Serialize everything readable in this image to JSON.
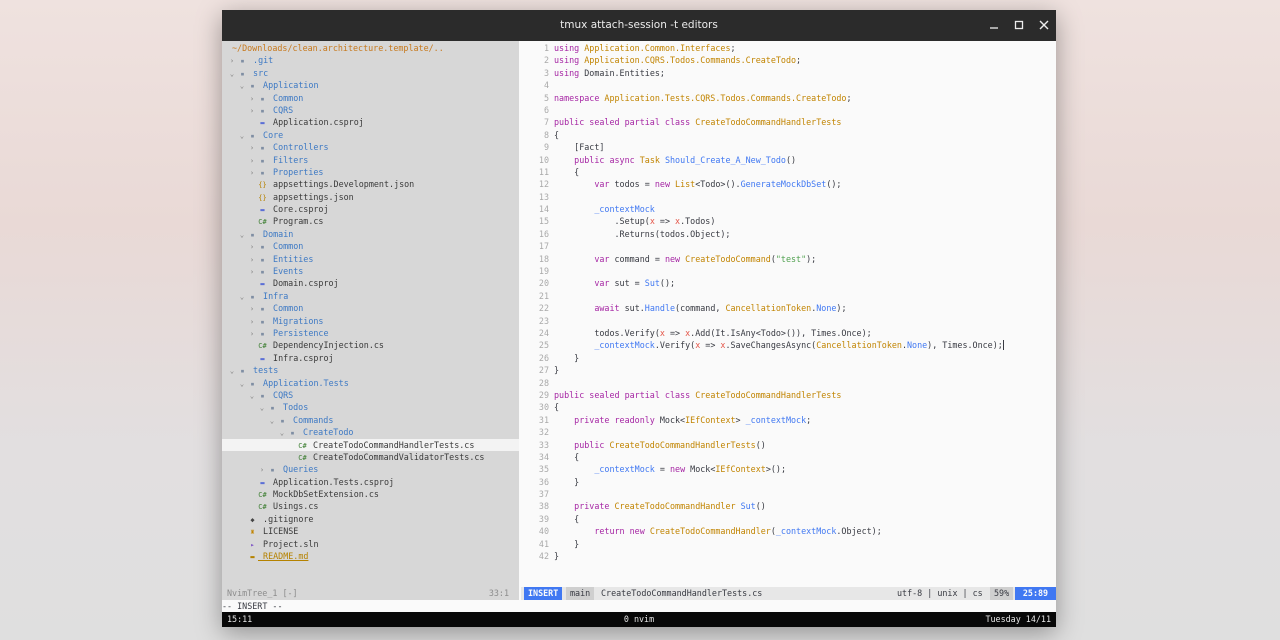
{
  "window": {
    "title": "tmux attach-session -t editors"
  },
  "sidebar": {
    "root": "~/Downloads/clean.architecture.template/..",
    "items": [
      {
        "depth": 0,
        "chev": "›",
        "icon": "folder",
        "name": ".git",
        "type": "dir"
      },
      {
        "depth": 0,
        "chev": "⌄",
        "icon": "folder",
        "name": "src",
        "type": "dir"
      },
      {
        "depth": 1,
        "chev": "⌄",
        "icon": "folder",
        "name": "Application",
        "type": "dir"
      },
      {
        "depth": 2,
        "chev": "›",
        "icon": "folder",
        "name": "Common",
        "type": "dir"
      },
      {
        "depth": 2,
        "chev": "›",
        "icon": "folder",
        "name": "CQRS",
        "type": "dir"
      },
      {
        "depth": 2,
        "chev": "",
        "icon": "csproj",
        "name": "Application.csproj",
        "type": "file"
      },
      {
        "depth": 1,
        "chev": "⌄",
        "icon": "folder",
        "name": "Core",
        "type": "dir"
      },
      {
        "depth": 2,
        "chev": "›",
        "icon": "folder",
        "name": "Controllers",
        "type": "dir"
      },
      {
        "depth": 2,
        "chev": "›",
        "icon": "folder",
        "name": "Filters",
        "type": "dir"
      },
      {
        "depth": 2,
        "chev": "›",
        "icon": "folder",
        "name": "Properties",
        "type": "dir"
      },
      {
        "depth": 2,
        "chev": "",
        "icon": "json",
        "name": "appsettings.Development.json",
        "type": "file"
      },
      {
        "depth": 2,
        "chev": "",
        "icon": "json",
        "name": "appsettings.json",
        "type": "file"
      },
      {
        "depth": 2,
        "chev": "",
        "icon": "csproj",
        "name": "Core.csproj",
        "type": "file"
      },
      {
        "depth": 2,
        "chev": "",
        "icon": "cs",
        "name": "Program.cs",
        "type": "file"
      },
      {
        "depth": 1,
        "chev": "⌄",
        "icon": "folder",
        "name": "Domain",
        "type": "dir"
      },
      {
        "depth": 2,
        "chev": "›",
        "icon": "folder",
        "name": "Common",
        "type": "dir"
      },
      {
        "depth": 2,
        "chev": "›",
        "icon": "folder",
        "name": "Entities",
        "type": "dir"
      },
      {
        "depth": 2,
        "chev": "›",
        "icon": "folder",
        "name": "Events",
        "type": "dir"
      },
      {
        "depth": 2,
        "chev": "",
        "icon": "csproj",
        "name": "Domain.csproj",
        "type": "file"
      },
      {
        "depth": 1,
        "chev": "⌄",
        "icon": "folder",
        "name": "Infra",
        "type": "dir"
      },
      {
        "depth": 2,
        "chev": "›",
        "icon": "folder",
        "name": "Common",
        "type": "dir"
      },
      {
        "depth": 2,
        "chev": "›",
        "icon": "folder",
        "name": "Migrations",
        "type": "dir"
      },
      {
        "depth": 2,
        "chev": "›",
        "icon": "folder",
        "name": "Persistence",
        "type": "dir"
      },
      {
        "depth": 2,
        "chev": "",
        "icon": "cs",
        "name": "DependencyInjection.cs",
        "type": "file"
      },
      {
        "depth": 2,
        "chev": "",
        "icon": "csproj",
        "name": "Infra.csproj",
        "type": "file"
      },
      {
        "depth": 0,
        "chev": "⌄",
        "icon": "folder",
        "name": "tests",
        "type": "dir"
      },
      {
        "depth": 1,
        "chev": "⌄",
        "icon": "folder",
        "name": "Application.Tests",
        "type": "dir"
      },
      {
        "depth": 2,
        "chev": "⌄",
        "icon": "folder",
        "name": "CQRS",
        "type": "dir"
      },
      {
        "depth": 3,
        "chev": "⌄",
        "icon": "folder",
        "name": "Todos",
        "type": "dir"
      },
      {
        "depth": 4,
        "chev": "⌄",
        "icon": "folder",
        "name": "Commands",
        "type": "dir"
      },
      {
        "depth": 5,
        "chev": "⌄",
        "icon": "folder",
        "name": "CreateTodo",
        "type": "dir"
      },
      {
        "depth": 6,
        "chev": "",
        "icon": "cs",
        "name": "CreateTodoCommandHandlerTests.cs",
        "type": "file",
        "selected": true
      },
      {
        "depth": 6,
        "chev": "",
        "icon": "cs",
        "name": "CreateTodoCommandValidatorTests.cs",
        "type": "file"
      },
      {
        "depth": 3,
        "chev": "›",
        "icon": "folder",
        "name": "Queries",
        "type": "dir"
      },
      {
        "depth": 2,
        "chev": "",
        "icon": "csproj",
        "name": "Application.Tests.csproj",
        "type": "file"
      },
      {
        "depth": 2,
        "chev": "",
        "icon": "cs",
        "name": "MockDbSetExtension.cs",
        "type": "file"
      },
      {
        "depth": 2,
        "chev": "",
        "icon": "cs",
        "name": "Usings.cs",
        "type": "file"
      },
      {
        "depth": 1,
        "chev": "",
        "icon": "git",
        "name": ".gitignore",
        "type": "file"
      },
      {
        "depth": 1,
        "chev": "",
        "icon": "license",
        "name": "LICENSE",
        "type": "file"
      },
      {
        "depth": 1,
        "chev": "",
        "icon": "sln",
        "name": "Project.sln",
        "type": "file"
      },
      {
        "depth": 1,
        "chev": "",
        "icon": "md",
        "name": "README.md",
        "type": "readme"
      }
    ]
  },
  "icon_glyphs": {
    "folder": "▪",
    "csproj": "▬",
    "json": "{}",
    "cs": "C#",
    "git": "◆",
    "license": "♜",
    "sln": "▸",
    "md": "▬"
  },
  "icon_colors": {
    "folder": "#7f8ea3",
    "csproj": "#5b6fd6",
    "json": "#b58200",
    "cs": "#3a7d2f",
    "git": "#444444",
    "license": "#c18401",
    "sln": "#7a4fc4",
    "md": "#b58200"
  },
  "editor": {
    "lines": [
      [
        [
          "k",
          "using "
        ],
        [
          "t",
          "Application.Common.Interfaces"
        ],
        [
          "x",
          ";"
        ]
      ],
      [
        [
          "k",
          "using "
        ],
        [
          "t",
          "Application.CQRS.Todos.Commands.CreateTodo"
        ],
        [
          "x",
          ";"
        ]
      ],
      [
        [
          "k",
          "using "
        ],
        [
          "x",
          "Domain.Entities;"
        ]
      ],
      [],
      [
        [
          "k",
          "namespace "
        ],
        [
          "t",
          "Application.Tests.CQRS.Todos.Commands.CreateTodo"
        ],
        [
          "x",
          ";"
        ]
      ],
      [],
      [
        [
          "k",
          "public sealed partial class "
        ],
        [
          "t",
          "CreateTodoCommandHandlerTests"
        ]
      ],
      [
        [
          "x",
          "{"
        ]
      ],
      [
        [
          "x",
          "    [Fact]"
        ]
      ],
      [
        [
          "x",
          "    "
        ],
        [
          "k",
          "public async "
        ],
        [
          "t",
          "Task "
        ],
        [
          "f",
          "Should_Create_A_New_Todo"
        ],
        [
          "x",
          "()"
        ]
      ],
      [
        [
          "x",
          "    {"
        ]
      ],
      [
        [
          "x",
          "        "
        ],
        [
          "k",
          "var "
        ],
        [
          "x",
          "todos = "
        ],
        [
          "k",
          "new "
        ],
        [
          "t",
          "List"
        ],
        [
          "x",
          "<Todo>()."
        ],
        [
          "f",
          "GenerateMockDbSet"
        ],
        [
          "x",
          "();"
        ]
      ],
      [],
      [
        [
          "x",
          "        "
        ],
        [
          "f",
          "_contextMock"
        ]
      ],
      [
        [
          "x",
          "            .Setup("
        ],
        [
          "m",
          "x"
        ],
        [
          "x",
          " => "
        ],
        [
          "m",
          "x"
        ],
        [
          "x",
          ".Todos)"
        ]
      ],
      [
        [
          "x",
          "            .Returns(todos.Object);"
        ]
      ],
      [],
      [
        [
          "x",
          "        "
        ],
        [
          "k",
          "var "
        ],
        [
          "x",
          "command = "
        ],
        [
          "k",
          "new "
        ],
        [
          "t",
          "CreateTodoCommand"
        ],
        [
          "x",
          "("
        ],
        [
          "s",
          "\"test\""
        ],
        [
          "x",
          ");"
        ]
      ],
      [],
      [
        [
          "x",
          "        "
        ],
        [
          "k",
          "var "
        ],
        [
          "x",
          "sut = "
        ],
        [
          "f",
          "Sut"
        ],
        [
          "x",
          "();"
        ]
      ],
      [],
      [
        [
          "x",
          "        "
        ],
        [
          "k",
          "await "
        ],
        [
          "x",
          "sut."
        ],
        [
          "f",
          "Handle"
        ],
        [
          "x",
          "(command, "
        ],
        [
          "t",
          "CancellationToken"
        ],
        [
          "x",
          "."
        ],
        [
          "f",
          "None"
        ],
        [
          "x",
          ");"
        ]
      ],
      [],
      [
        [
          "x",
          "        todos.Verify("
        ],
        [
          "m",
          "x"
        ],
        [
          "x",
          " => "
        ],
        [
          "m",
          "x"
        ],
        [
          "x",
          ".Add(It.IsAny<Todo>()), Times.Once);"
        ]
      ],
      [
        [
          "x",
          "        "
        ],
        [
          "f",
          "_contextMock"
        ],
        [
          "x",
          ".Verify("
        ],
        [
          "m",
          "x"
        ],
        [
          "x",
          " => "
        ],
        [
          "m",
          "x"
        ],
        [
          "x",
          ".SaveChangesAsync("
        ],
        [
          "t",
          "CancellationToken"
        ],
        [
          "x",
          "."
        ],
        [
          "f",
          "None"
        ],
        [
          "x",
          "), Times.Once)"
        ],
        [
          "c",
          ";"
        ]
      ],
      [
        [
          "x",
          "    }"
        ]
      ],
      [
        [
          "x",
          "}"
        ]
      ],
      [],
      [
        [
          "k",
          "public sealed partial class "
        ],
        [
          "t",
          "CreateTodoCommandHandlerTests"
        ]
      ],
      [
        [
          "x",
          "{"
        ]
      ],
      [
        [
          "x",
          "    "
        ],
        [
          "k",
          "private readonly "
        ],
        [
          "x",
          "Mock<"
        ],
        [
          "t",
          "IEfContext"
        ],
        [
          "x",
          "> "
        ],
        [
          "f",
          "_contextMock"
        ],
        [
          "x",
          ";"
        ]
      ],
      [],
      [
        [
          "x",
          "    "
        ],
        [
          "k",
          "public "
        ],
        [
          "t",
          "CreateTodoCommandHandlerTests"
        ],
        [
          "x",
          "()"
        ]
      ],
      [
        [
          "x",
          "    {"
        ]
      ],
      [
        [
          "x",
          "        "
        ],
        [
          "f",
          "_contextMock"
        ],
        [
          "x",
          " = "
        ],
        [
          "k",
          "new "
        ],
        [
          "x",
          "Mock<"
        ],
        [
          "t",
          "IEfContext"
        ],
        [
          "x",
          ">();"
        ]
      ],
      [
        [
          "x",
          "    }"
        ]
      ],
      [],
      [
        [
          "x",
          "    "
        ],
        [
          "k",
          "private "
        ],
        [
          "t",
          "CreateTodoCommandHandler "
        ],
        [
          "f",
          "Sut"
        ],
        [
          "x",
          "()"
        ]
      ],
      [
        [
          "x",
          "    {"
        ]
      ],
      [
        [
          "x",
          "        "
        ],
        [
          "k",
          "return new "
        ],
        [
          "t",
          "CreateTodoCommandHandler"
        ],
        [
          "x",
          "("
        ],
        [
          "f",
          "_contextMock"
        ],
        [
          "x",
          ".Object);"
        ]
      ],
      [
        [
          "x",
          "    }"
        ]
      ],
      [
        [
          "x",
          "}"
        ]
      ]
    ]
  },
  "statusline": {
    "tree_name": "NvimTree_1 [-]",
    "tree_pos": "33:1",
    "mode": "INSERT",
    "branch": "main",
    "file": "CreateTodoCommandHandlerTests.cs",
    "encoding": "utf-8 | unix | cs",
    "percent": "59%",
    "linecol": "25:89"
  },
  "cmdline": {
    "text": "-- INSERT --"
  },
  "tmux": {
    "clock": "15:11",
    "window": "0 nvim",
    "date": "Tuesday 14/11"
  }
}
